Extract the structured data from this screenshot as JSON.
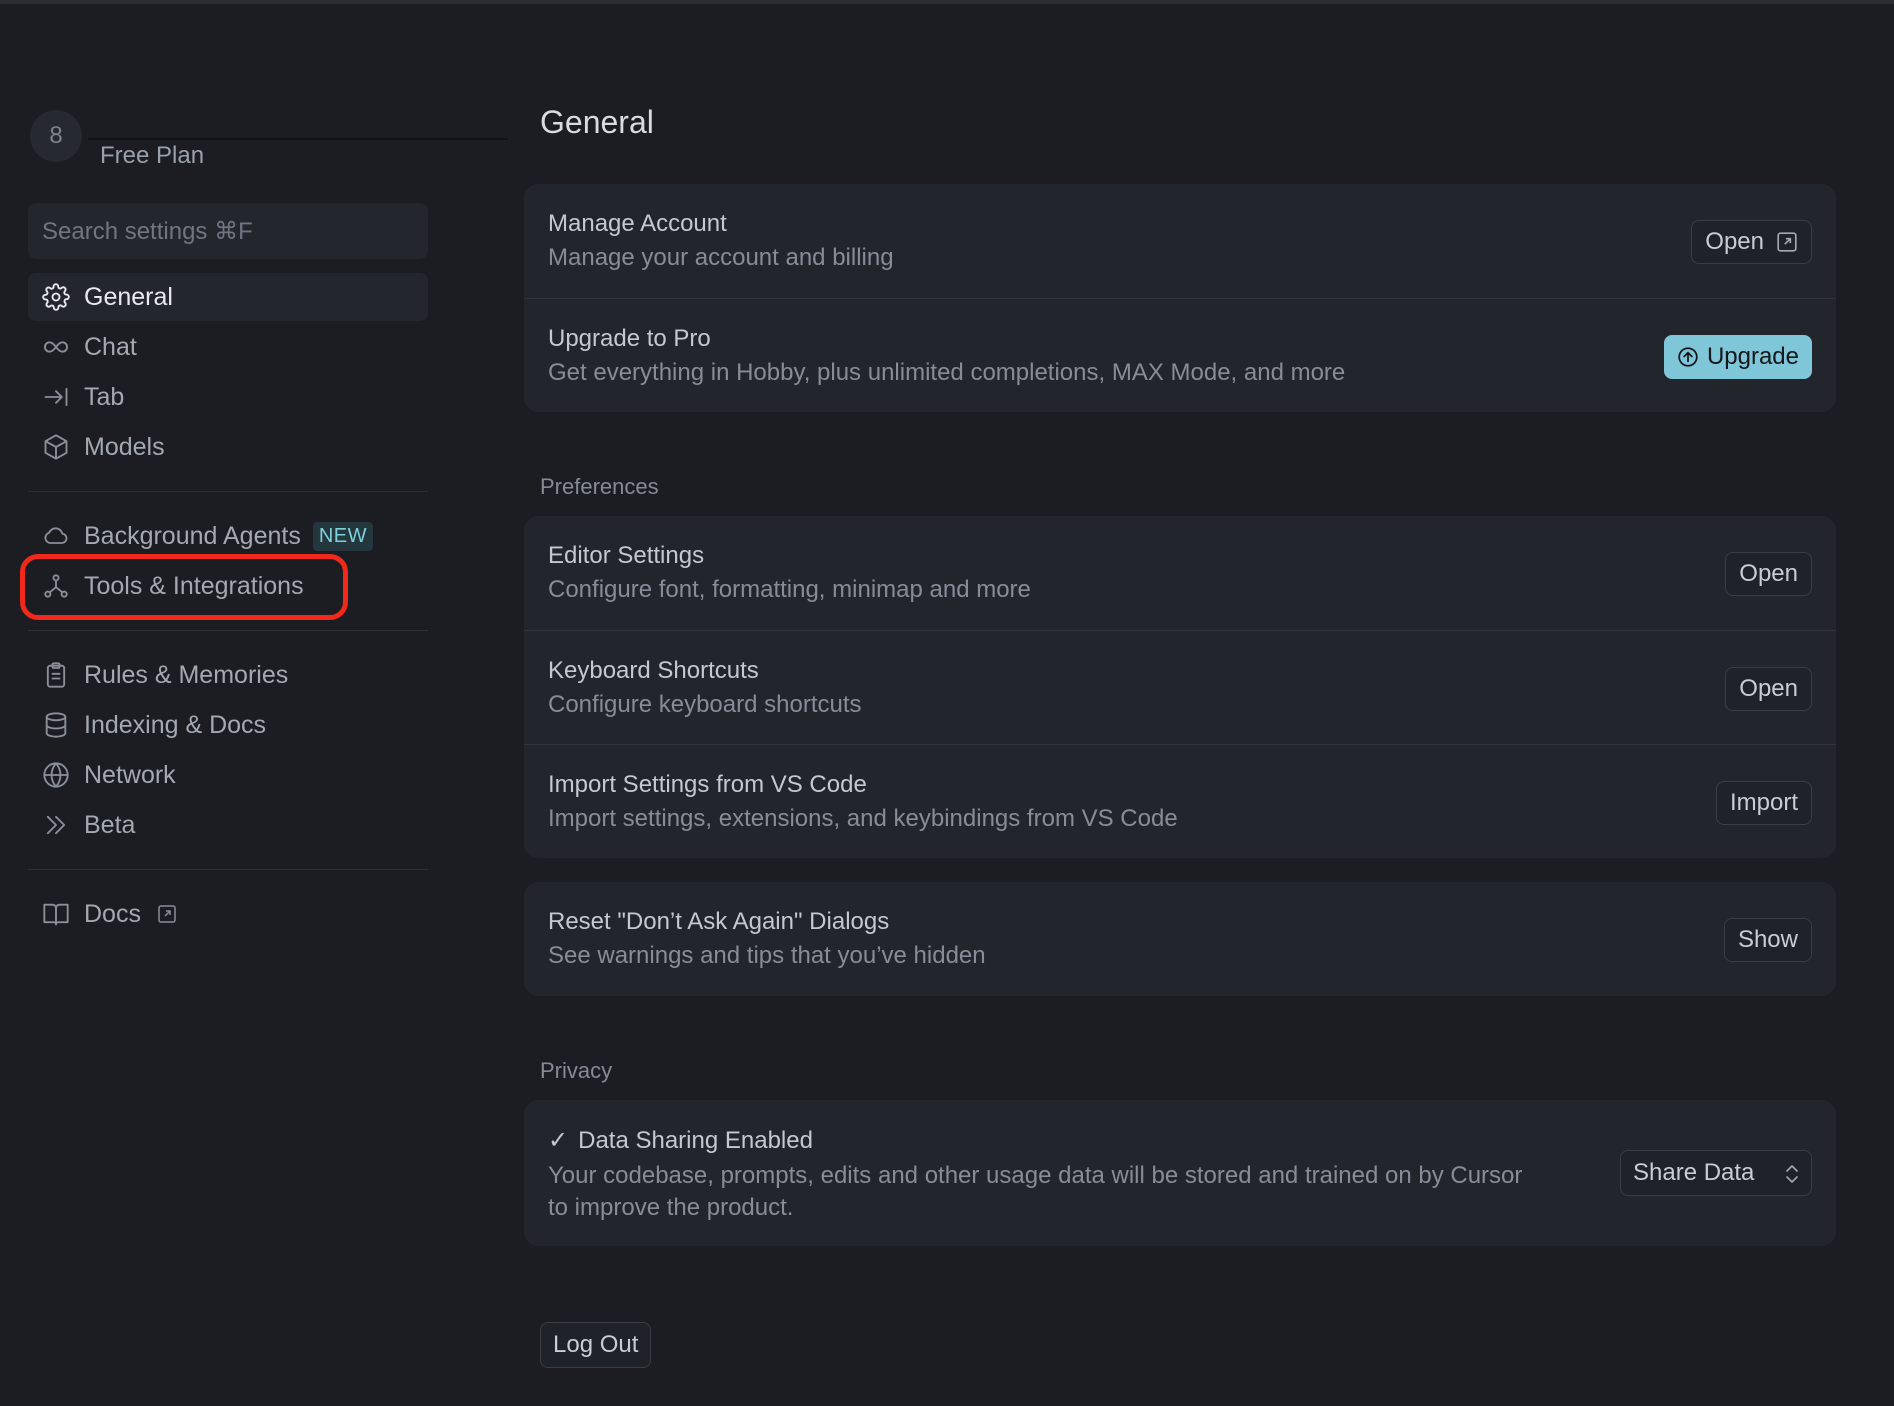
{
  "profile": {
    "avatar_initial": "8",
    "plan": "Free Plan"
  },
  "search": {
    "placeholder": "Search settings ⌘F"
  },
  "sidebar": {
    "items": [
      {
        "label": "General",
        "icon": "gear-icon",
        "active": true
      },
      {
        "label": "Chat",
        "icon": "infinity-icon"
      },
      {
        "label": "Tab",
        "icon": "tab-arrow-icon"
      },
      {
        "label": "Models",
        "icon": "cube-icon"
      },
      {
        "label": "Background Agents",
        "icon": "cloud-icon",
        "badge": "NEW"
      },
      {
        "label": "Tools & Integrations",
        "icon": "integrations-icon",
        "highlighted": true
      },
      {
        "label": "Rules & Memories",
        "icon": "clipboard-icon"
      },
      {
        "label": "Indexing & Docs",
        "icon": "database-icon"
      },
      {
        "label": "Network",
        "icon": "globe-icon"
      },
      {
        "label": "Beta",
        "icon": "double-chevron-icon"
      },
      {
        "label": "Docs",
        "icon": "book-icon",
        "external": true
      }
    ]
  },
  "main": {
    "title": "General",
    "account": {
      "manage_title": "Manage Account",
      "manage_desc": "Manage your account and billing",
      "manage_button": "Open",
      "upgrade_title": "Upgrade to Pro",
      "upgrade_desc": "Get everything in Hobby, plus unlimited completions, MAX Mode, and more",
      "upgrade_button": "Upgrade"
    },
    "preferences": {
      "label": "Preferences",
      "editor_title": "Editor Settings",
      "editor_desc": "Configure font, formatting, minimap and more",
      "editor_button": "Open",
      "keyboard_title": "Keyboard Shortcuts",
      "keyboard_desc": "Configure keyboard shortcuts",
      "keyboard_button": "Open",
      "import_title": "Import Settings from VS Code",
      "import_desc": "Import settings, extensions, and keybindings from VS Code",
      "import_button": "Import"
    },
    "reset": {
      "title": "Reset \"Don’t Ask Again\" Dialogs",
      "desc": "See warnings and tips that you’ve hidden",
      "button": "Show"
    },
    "privacy": {
      "label": "Privacy",
      "check": "✓",
      "title": "Data Sharing Enabled",
      "desc": "Your codebase, prompts, edits and other usage data will be stored and trained on by Cursor to improve the product.",
      "select_value": "Share Data"
    },
    "logout_button": "Log Out"
  },
  "colors": {
    "accent": "#7ec6d8",
    "highlight": "#f0291a",
    "background": "#1b1d23",
    "card": "#22252c"
  }
}
